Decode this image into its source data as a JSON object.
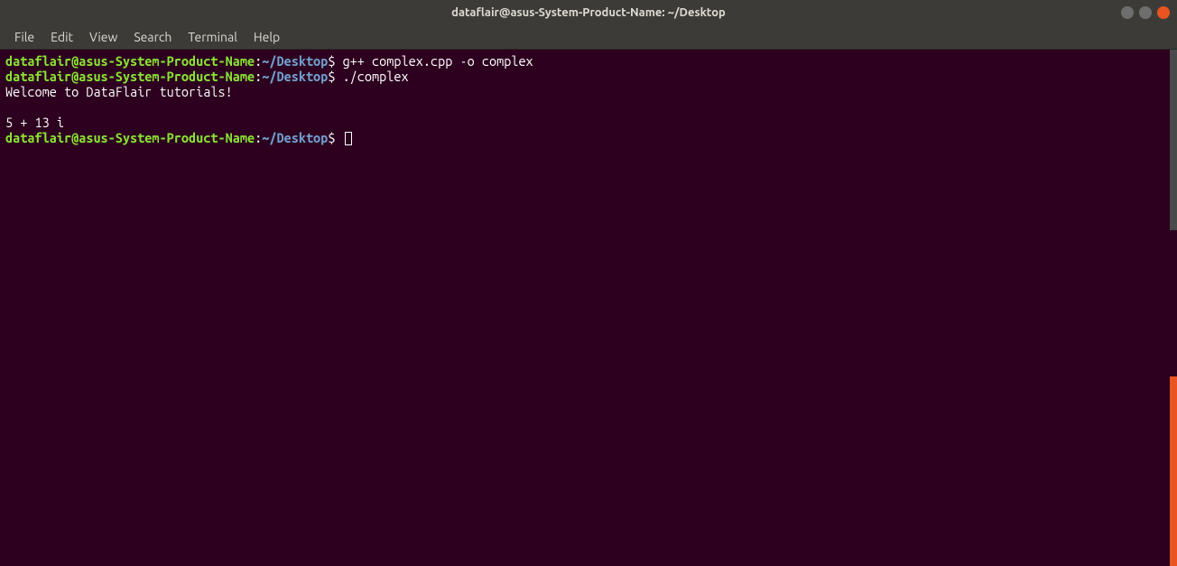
{
  "window": {
    "title": "dataflair@asus-System-Product-Name: ~/Desktop"
  },
  "menubar": {
    "items": [
      "File",
      "Edit",
      "View",
      "Search",
      "Terminal",
      "Help"
    ]
  },
  "prompt": {
    "user_host": "dataflair@asus-System-Product-Name",
    "colon": ":",
    "path_tilde": "~/Desktop",
    "dollar": "$"
  },
  "lines": [
    {
      "type": "prompt",
      "command": "g++ complex.cpp -o complex"
    },
    {
      "type": "prompt",
      "command": "./complex"
    },
    {
      "type": "output",
      "text": "Welcome to DataFlair tutorials!"
    },
    {
      "type": "blank",
      "text": ""
    },
    {
      "type": "output",
      "text": "5 + 13 i"
    },
    {
      "type": "prompt",
      "command": "",
      "cursor": true
    }
  ]
}
